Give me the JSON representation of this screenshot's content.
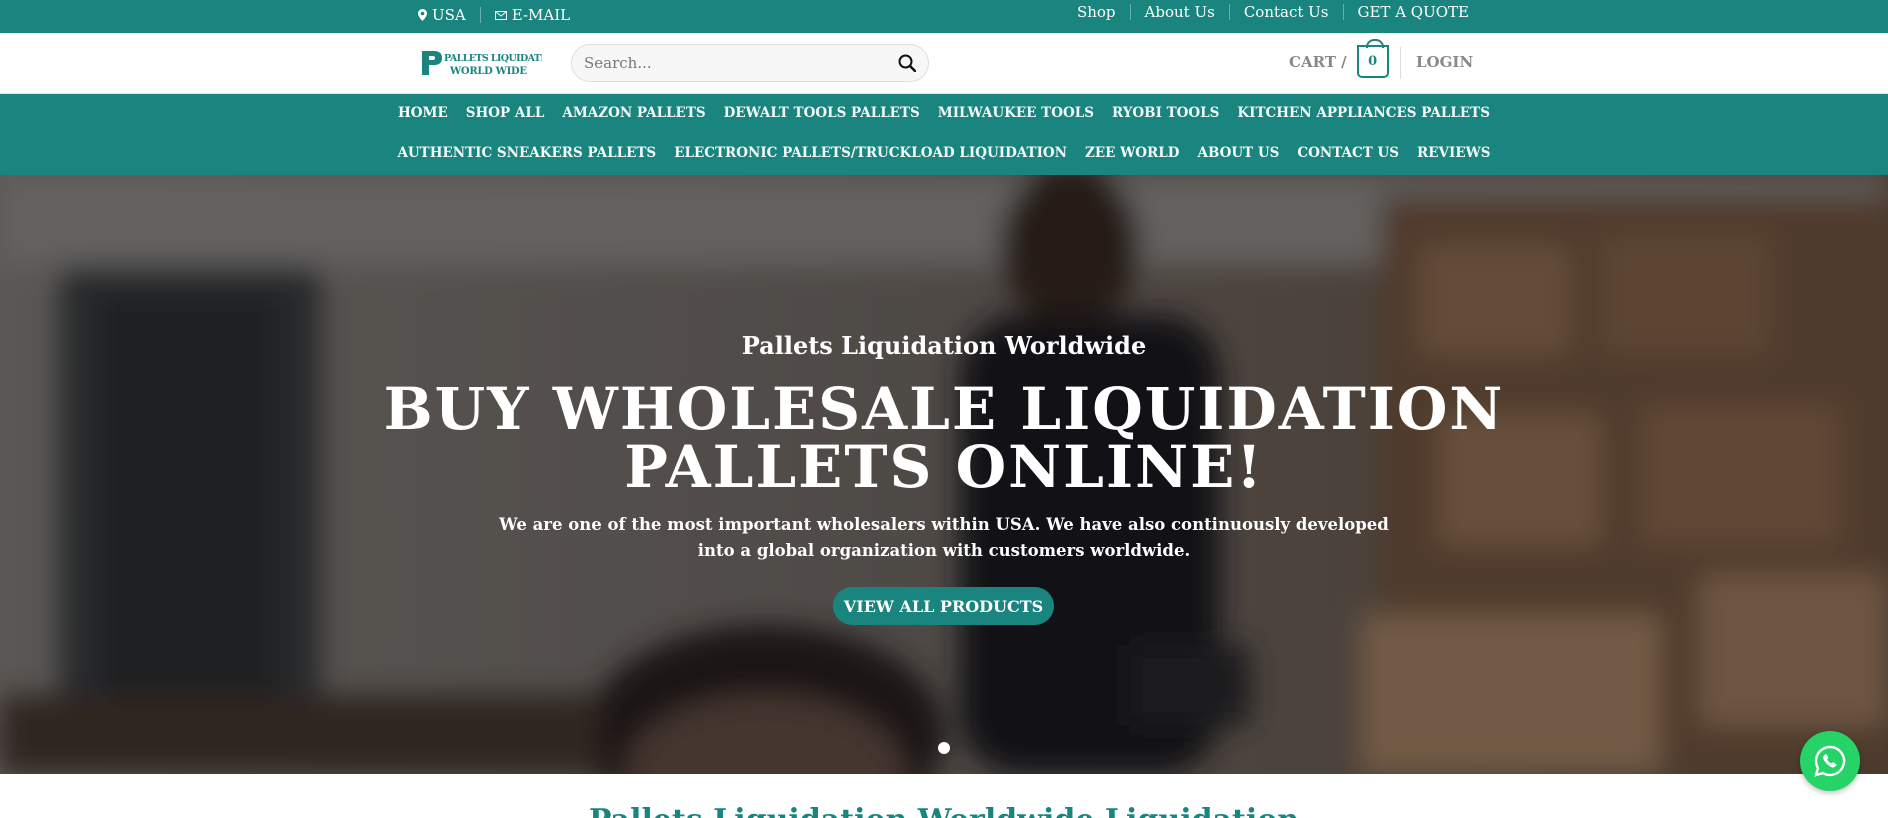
{
  "topbar": {
    "location": "USA",
    "email": "E-MAIL",
    "links": {
      "shop": "Shop",
      "about": "About Us",
      "contact": "Contact Us",
      "quote": "GET A QUOTE"
    }
  },
  "header": {
    "logo_text_1": "PALLETS LIQUIDATION",
    "logo_text_2": "WORLD WIDE",
    "search_placeholder": "Search...",
    "cart_label": "CART /",
    "cart_count": "0",
    "login_label": "LOGIN"
  },
  "nav": {
    "row1": [
      "HOME",
      "SHOP ALL",
      "AMAZON PALLETS",
      "DEWALT TOOLS PALLETS",
      "MILWAUKEE TOOLS",
      "RYOBI TOOLS",
      "KITCHEN APPLIANCES PALLETS"
    ],
    "row2": [
      "AUTHENTIC SNEAKERS PALLETS",
      "ELECTRONIC PALLETS/TRUCKLOAD LIQUIDATION",
      "ZEE WORLD",
      "ABOUT US",
      "CONTACT US",
      "REVIEWS"
    ]
  },
  "hero": {
    "kicker": "Pallets Liquidation Worldwide",
    "title_line1": "BUY WHOLESALE LIQUIDATION",
    "title_line2": "PALLETS ONLINE!",
    "description": "We are one of the most important wholesalers within USA. We have also continuously developed into a global organization with customers worldwide.",
    "cta": "VIEW ALL PRODUCTS"
  },
  "section": {
    "title": "Pallets Liquidation Worldwide Liquidation"
  },
  "colors": {
    "brand": "#1a857f",
    "chat": "#25d366"
  }
}
